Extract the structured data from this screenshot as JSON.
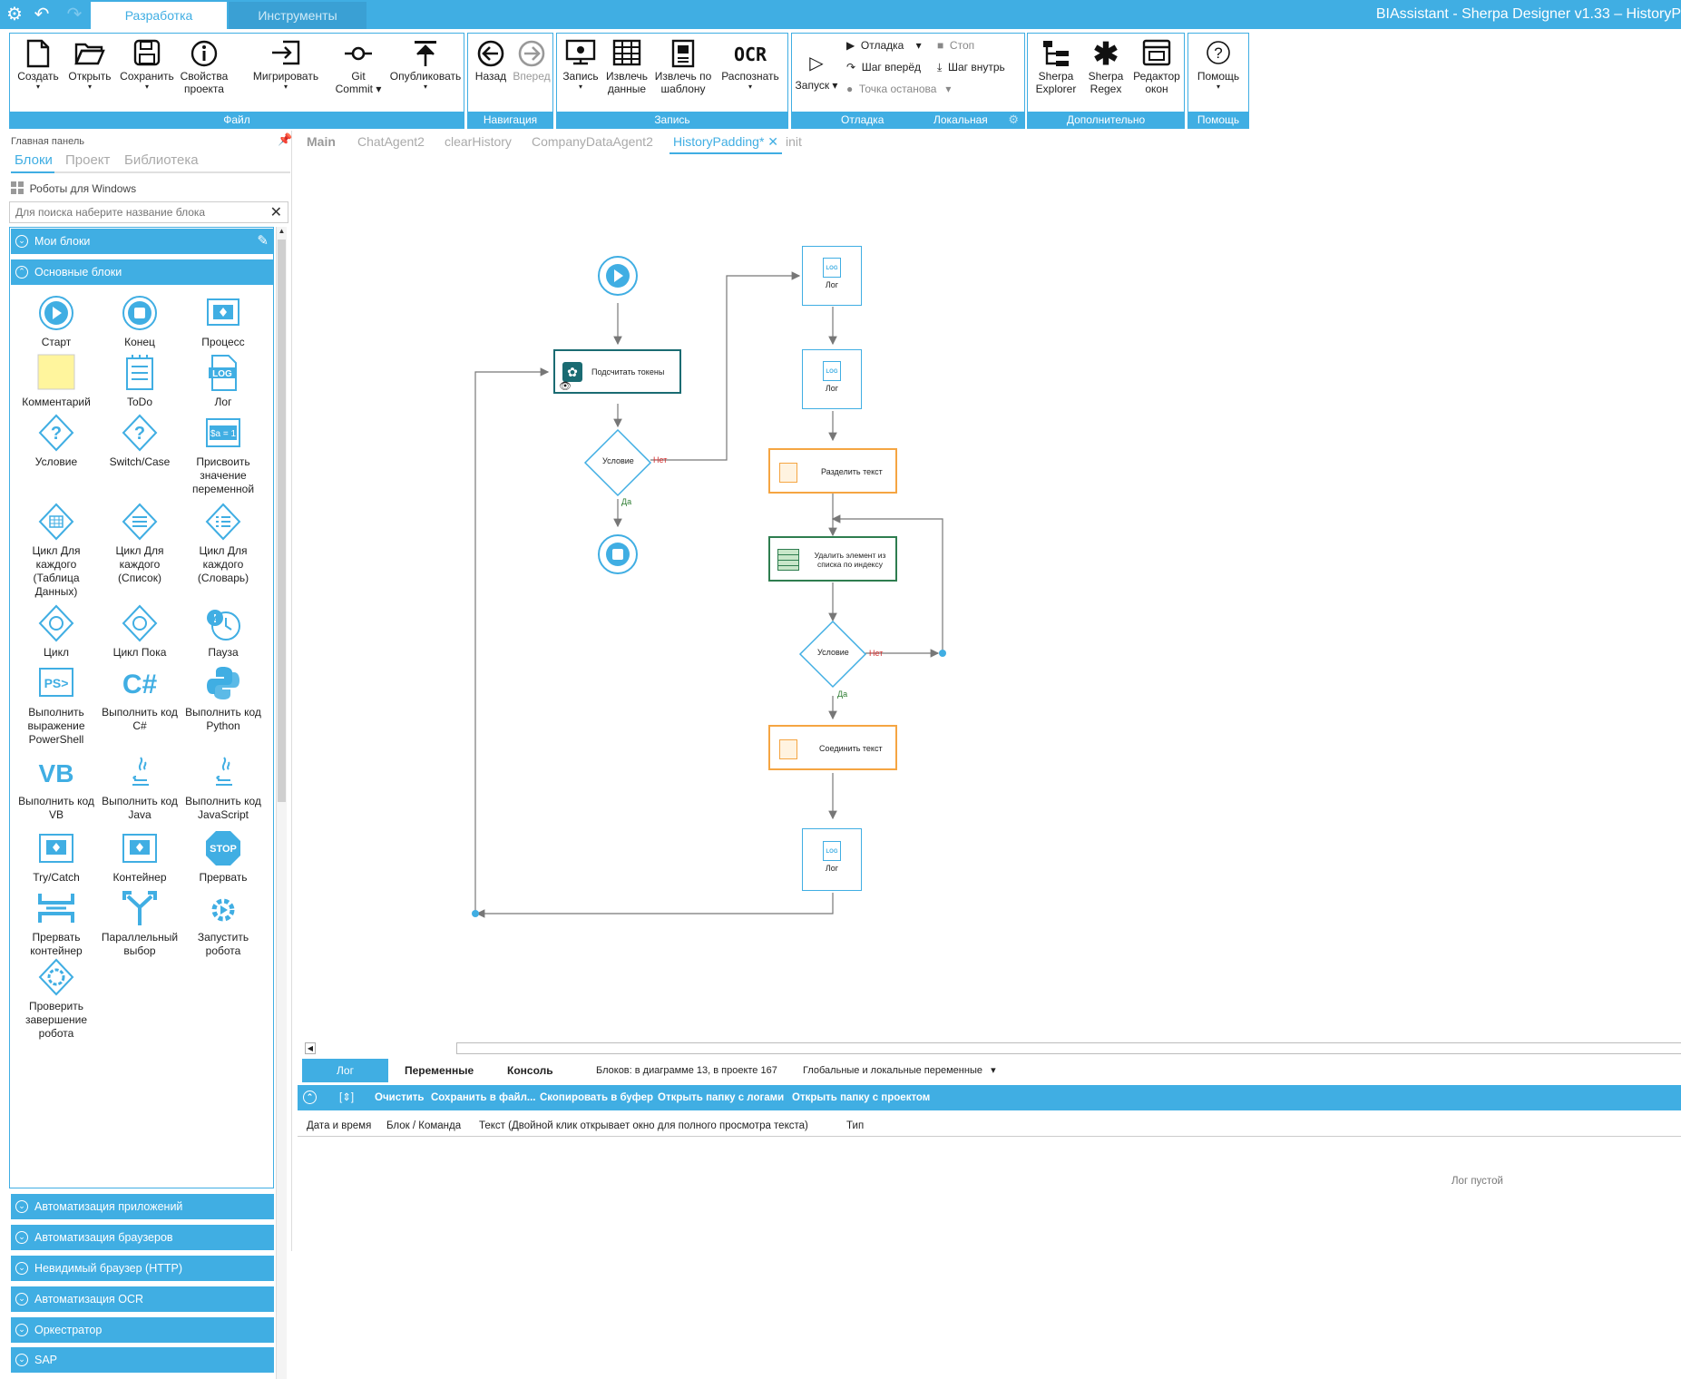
{
  "app": {
    "title": "BIAssistant - Sherpa Designer v1.33 – HistoryP",
    "tabs": [
      "Разработка",
      "Инструменты"
    ]
  },
  "ribbon": {
    "groups": {
      "file": "Файл",
      "nav": "Навигация",
      "record": "Запись",
      "debug": "Отладка",
      "local": "Локальная",
      "extra": "Дополнительно",
      "help": "Помощь"
    },
    "file": {
      "create": "Создать",
      "open": "Открыть",
      "save": "Сохранить",
      "props_1": "Свойства",
      "props_2": "проекта",
      "migrate": "Мигрировать",
      "git_1": "Git",
      "git_2": "Commit",
      "publish": "Опубликовать"
    },
    "nav": {
      "back": "Назад",
      "forward": "Вперед"
    },
    "record": {
      "record": "Запись",
      "extract_1": "Извлечь",
      "extract_2": "данные",
      "extract_tpl_1": "Извлечь по",
      "extract_tpl_2": "шаблону",
      "recognize": "Распознать"
    },
    "debug": {
      "run": "Запуск",
      "debug": "Отладка",
      "stop": "Стоп",
      "step_over": "Шаг вперёд",
      "step_into": "Шаг внутрь",
      "breakpoint": "Точка останова"
    },
    "extra": {
      "explorer_1": "Sherpa",
      "explorer_2": "Explorer",
      "regex_1": "Sherpa",
      "regex_2": "Regex",
      "editor_1": "Редактор",
      "editor_2": "окон"
    },
    "help": {
      "help": "Помощь"
    }
  },
  "sidebar": {
    "header": "Главная панель",
    "tabs": [
      "Блоки",
      "Проект",
      "Библиотека"
    ],
    "robots": "Роботы для Windows",
    "search_placeholder": "Для поиска наберите название блока",
    "my_blocks": "Мои блоки",
    "basic_blocks": "Основные блоки",
    "blocks": [
      {
        "l1": "Старт",
        "l2": "",
        "l3": "",
        "l4": "",
        "icon": "start-icon"
      },
      {
        "l1": "Конец",
        "l2": "",
        "l3": "",
        "l4": "",
        "icon": "end-icon"
      },
      {
        "l1": "Процесс",
        "l2": "",
        "l3": "",
        "l4": "",
        "icon": "process-icon"
      },
      {
        "l1": "Комментарий",
        "l2": "",
        "l3": "",
        "l4": "",
        "icon": "comment-icon"
      },
      {
        "l1": "ToDo",
        "l2": "",
        "l3": "",
        "l4": "",
        "icon": "todo-icon"
      },
      {
        "l1": "Лог",
        "l2": "",
        "l3": "",
        "l4": "",
        "icon": "log-icon"
      },
      {
        "l1": "Условие",
        "l2": "",
        "l3": "",
        "l4": "",
        "icon": "condition-icon"
      },
      {
        "l1": "Switch/Case",
        "l2": "",
        "l3": "",
        "l4": "",
        "icon": "switch-case-icon"
      },
      {
        "l1": "Присвоить",
        "l2": "значение",
        "l3": "переменной",
        "l4": "",
        "icon": "assign-icon"
      },
      {
        "l1": "Цикл Для",
        "l2": "каждого",
        "l3": "(Таблица",
        "l4": "Данных)",
        "icon": "foreach-table-icon"
      },
      {
        "l1": "Цикл Для",
        "l2": "каждого",
        "l3": "(Список)",
        "l4": "",
        "icon": "foreach-list-icon"
      },
      {
        "l1": "Цикл Для",
        "l2": "каждого",
        "l3": "(Словарь)",
        "l4": "",
        "icon": "foreach-dict-icon"
      },
      {
        "l1": "Цикл",
        "l2": "",
        "l3": "",
        "l4": "",
        "icon": "loop-icon"
      },
      {
        "l1": "Цикл Пока",
        "l2": "",
        "l3": "",
        "l4": "",
        "icon": "while-loop-icon"
      },
      {
        "l1": "Пауза",
        "l2": "",
        "l3": "",
        "l4": "",
        "icon": "pause-icon"
      },
      {
        "l1": "Выполнить",
        "l2": "выражение",
        "l3": "PowerShell",
        "l4": "",
        "icon": "powershell-icon"
      },
      {
        "l1": "Выполнить код",
        "l2": "C#",
        "l3": "",
        "l4": "",
        "icon": "csharp-icon"
      },
      {
        "l1": "Выполнить код",
        "l2": "Python",
        "l3": "",
        "l4": "",
        "icon": "python-icon"
      },
      {
        "l1": "Выполнить код",
        "l2": "VB",
        "l3": "",
        "l4": "",
        "icon": "vb-icon"
      },
      {
        "l1": "Выполнить код",
        "l2": "Java",
        "l3": "",
        "l4": "",
        "icon": "java-icon"
      },
      {
        "l1": "Выполнить код",
        "l2": "JavaScript",
        "l3": "",
        "l4": "",
        "icon": "javascript-icon"
      },
      {
        "l1": "Try/Catch",
        "l2": "",
        "l3": "",
        "l4": "",
        "icon": "try-catch-icon"
      },
      {
        "l1": "Контейнер",
        "l2": "",
        "l3": "",
        "l4": "",
        "icon": "container-icon"
      },
      {
        "l1": "Прервать",
        "l2": "",
        "l3": "",
        "l4": "",
        "icon": "stop-icon"
      },
      {
        "l1": "Прервать",
        "l2": "контейнер",
        "l3": "",
        "l4": "",
        "icon": "break-container-icon"
      },
      {
        "l1": "Параллельный",
        "l2": "выбор",
        "l3": "",
        "l4": "",
        "icon": "parallel-choice-icon"
      },
      {
        "l1": "Запустить",
        "l2": "робота",
        "l3": "",
        "l4": "",
        "icon": "run-robot-icon"
      },
      {
        "l1": "Проверить",
        "l2": "завершение",
        "l3": "робота",
        "l4": "",
        "icon": "check-robot-icon"
      }
    ],
    "categories": [
      "Автоматизация приложений",
      "Автоматизация браузеров",
      "Невидимый браузер (HTTP)",
      "Автоматизация OCR",
      "Оркестратор",
      "SAP"
    ]
  },
  "doc_tabs": [
    "Main",
    "ChatAgent2",
    "clearHistory",
    "CompanyDataAgent2",
    "HistoryPadding*",
    "init"
  ],
  "diagram": {
    "count_tokens": "Подсчитать токены",
    "condition": "Условие",
    "no": "Нет",
    "yes": "Да",
    "log": "Лог",
    "split_text": "Разделить текст",
    "remove_item_1": "Удалить элемент из",
    "remove_item_2": "списка по индексу",
    "join_text": "Соединить текст"
  },
  "bottom": {
    "tabs": [
      "Лог",
      "Переменные",
      "Консоль"
    ],
    "blocks_info": "Блоков: в диаграмме 13, в проекте 167",
    "vars_scope": "Глобальные и локальные переменные",
    "actions": [
      "Очистить",
      "Сохранить в файл...",
      "Скопировать в буфер",
      "Открыть папку с логами",
      "Открыть папку с проектом"
    ],
    "columns": [
      "Дата и время",
      "Блок / Команда",
      "Текст (Двойной клик открывает окно для полного просмотра текста)",
      "Тип"
    ],
    "empty": "Лог пустой"
  },
  "colors": {
    "accent": "#40aee3",
    "orange": "#f5a542",
    "green": "#2e7d4f",
    "teal": "#1a6b72",
    "no": "#d32f2f",
    "yes": "#2e7d32"
  }
}
